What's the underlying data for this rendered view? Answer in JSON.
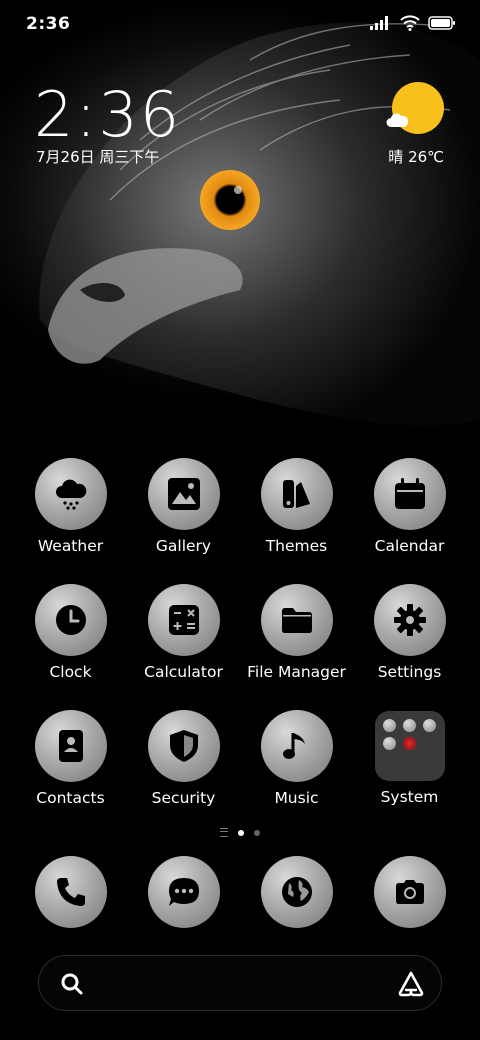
{
  "status_bar": {
    "time": "2:36",
    "icons": [
      "signal-icon",
      "wifi-icon",
      "battery-icon"
    ]
  },
  "lock_widget": {
    "clock": "2:36",
    "date": "7月26日 周三下午",
    "weather": "晴 26℃",
    "sun_color": "#f8c01a"
  },
  "apps": [
    {
      "label": "Weather",
      "icon": "weather-icon"
    },
    {
      "label": "Gallery",
      "icon": "gallery-icon"
    },
    {
      "label": "Themes",
      "icon": "themes-icon"
    },
    {
      "label": "Calendar",
      "icon": "calendar-icon"
    },
    {
      "label": "Clock",
      "icon": "clock-icon"
    },
    {
      "label": "Calculator",
      "icon": "calculator-icon"
    },
    {
      "label": "File Manager",
      "icon": "folder-icon"
    },
    {
      "label": "Settings",
      "icon": "gear-icon"
    },
    {
      "label": "Contacts",
      "icon": "contacts-icon"
    },
    {
      "label": "Security",
      "icon": "shield-icon"
    },
    {
      "label": "Music",
      "icon": "music-note-icon"
    },
    {
      "label": "System",
      "icon": "folder-grid-icon"
    }
  ],
  "page_indicator": {
    "pages": 2,
    "current": 1
  },
  "dock": [
    {
      "icon": "phone-icon"
    },
    {
      "icon": "message-icon"
    },
    {
      "icon": "browser-globe-icon"
    },
    {
      "icon": "camera-icon"
    }
  ],
  "search": {
    "icon": "search-icon",
    "assistant_icon": "assistant-icon"
  }
}
